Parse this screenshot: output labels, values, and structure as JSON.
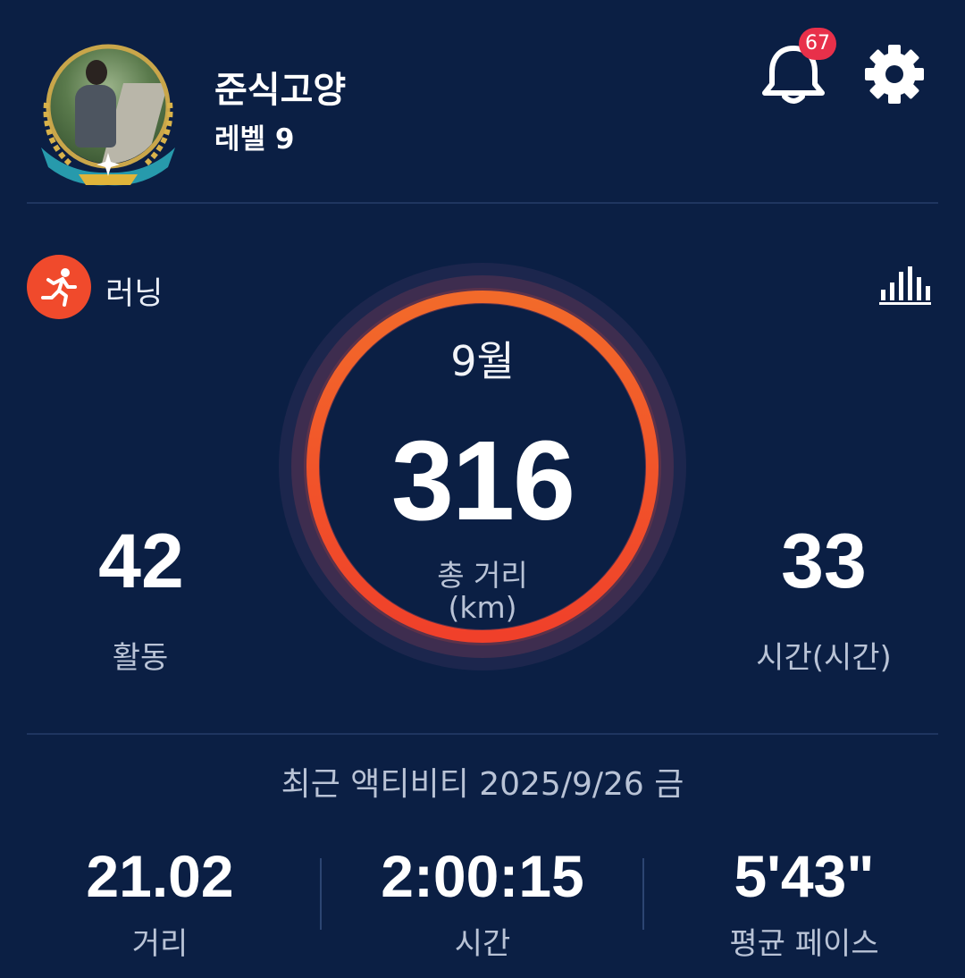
{
  "profile": {
    "username": "준식고양",
    "level": "레벨 9",
    "notification_count": "67"
  },
  "icons": {
    "bell": "bell-icon",
    "settings": "gear-icon",
    "activity": "running-person-icon",
    "stats": "bar-chart-icon"
  },
  "activity": {
    "type_label": "러닝"
  },
  "summary": {
    "month": "9월",
    "total_distance": "316",
    "total_distance_label": "총 거리",
    "total_distance_unit": "(km)",
    "activities_value": "42",
    "activities_label": "활동",
    "hours_value": "33",
    "hours_label": "시간(시간)"
  },
  "recent": {
    "heading": "최근 액티비티 2025/9/26 금",
    "distance_value": "21.02",
    "distance_label": "거리",
    "time_value": "2:00:15",
    "time_label": "시간",
    "pace_value": "5'43\"",
    "pace_label": "평균 페이스"
  },
  "colors": {
    "background": "#0b1f44",
    "accent_orange": "#f04a2c",
    "badge_red": "#e8304a",
    "muted_text": "#b9c3d6"
  }
}
